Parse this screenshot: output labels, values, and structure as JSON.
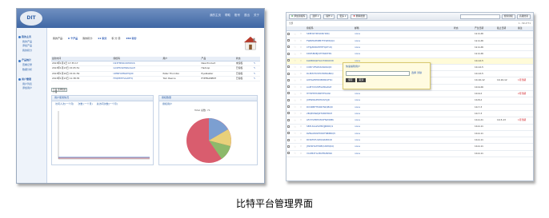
{
  "caption": "比特平台管理界面",
  "left": {
    "logo": "DIT",
    "top_links": [
      "我的主页",
      "帮助",
      "账号",
      "退出",
      "关于"
    ],
    "sidebar": [
      {
        "head": "我的主页",
        "items": [
          "我的产品",
          "添加产品",
          "我的积分"
        ]
      },
      {
        "head": "产品统计",
        "items": [
          "查看记录",
          "数据分析"
        ]
      },
      {
        "head": "用户管理",
        "items": [
          "用户列表",
          "添加用户"
        ]
      }
    ],
    "stats": {
      "label1": "我的产品:",
      "value1": "6 个产品",
      "label2": "我的积分:",
      "value2": "11 积分",
      "label3": "积 分 值:",
      "value3": "150 积分"
    },
    "table": {
      "headers": [
        "最新时间",
        "授权码",
        "用户",
        "产品",
        "状态",
        ""
      ],
      "rows": [
        [
          "2013年1月1日 17:35:17",
          "D23FMWKXDHWC6",
          "",
          "New Product",
          "未授权",
          "✎"
        ],
        [
          "2013年1月13日 15:05:51",
          "GCRFKSRHRAQGAH",
          "",
          "Hadoop",
          "已授权",
          "✎"
        ],
        [
          "2013年1月10日 15:01:59",
          "UMNTCMMAH5J9X",
          "Peter Thornton",
          "Eyeblaster",
          "已授权",
          "✎"
        ],
        [
          "2013年1月13日 11:38:35",
          "FPQE8THVGXEFQ",
          "Tom Pearce",
          "EYEFRAMENT",
          "已授权",
          "✎"
        ]
      ]
    },
    "product_select": "产品 选择您的产品",
    "panel1": {
      "title": "用户使用情况",
      "legend": [
        "访问人次(一个月)",
        "次数 (一个月)",
        "总访问次数(一个月)"
      ]
    },
    "panel2": {
      "title": "授权数量",
      "legend": [
        "授权用户"
      ],
      "pie_label": "Total 总数: 71"
    }
  },
  "right": {
    "toolbar": {
      "add": "添加授权码",
      "select": "选择",
      "ops": "操作",
      "more": "更多",
      "delete": "删除批量",
      "search_btn": "搜索授权",
      "advanced": "高级搜索"
    },
    "pager": {
      "left": "全部",
      "right": "1 - 50 of 71"
    },
    "headers": [
      "",
      "",
      "",
      "授权码",
      "邮箱",
      "状态",
      "产生日期",
      "截止日期",
      "备注"
    ],
    "rows": [
      [
        "SRM3Z7ZKSKNYKRQ",
        "none",
        "12-4-26",
        "",
        ""
      ],
      [
        "FWREDZMPB7FXWMQQ4",
        "none",
        "12-4-26",
        "",
        ""
      ],
      [
        "CTSJZDRKHEHFQZ7UQ",
        "none",
        "12-4-26",
        "",
        ""
      ],
      [
        "KDR5BDEJCPT6WKTRS",
        "none",
        "12-4-26",
        "",
        ""
      ],
      [
        "KLWB0QWYACYDRDAYW",
        "none",
        "10-12-5",
        "",
        ""
      ],
      [
        "CUB7UFSRSSDWAKQD",
        "none",
        "10-12-5",
        "",
        ""
      ],
      [
        "DLEMVHVKTCHRMGBKQ",
        "none",
        "10-12-5",
        "",
        ""
      ],
      [
        "LNHGZBHD9EZRR4FSC",
        "none",
        "10-10-12",
        "10-10-12",
        "1月到期"
      ],
      [
        "LGEHYXUMFGMRLZGE",
        "none",
        "10-9-26",
        "",
        ""
      ],
      [
        "HTHPTPHXBPHT5GWI",
        "none",
        "10-9-2",
        "",
        "2月到期"
      ],
      [
        "JUPWNGPWHK9VQJD",
        "none",
        "10-8-2",
        "",
        ""
      ],
      [
        "DUSBBTTMXRHWQBQD",
        "none",
        "10-7-3",
        "",
        ""
      ],
      [
        "2BQEDNWJZTKBKTRKH",
        "none",
        "10-7-3",
        "",
        ""
      ],
      [
        "LEOYSHBHUMXFNWRMK",
        "none",
        "10-4-21",
        "10-5-13",
        "1月到期"
      ],
      [
        "SEZUGGZGHBVJJRRRQ1",
        "none",
        "10-4-11",
        "",
        ""
      ],
      [
        "RZNAKEAPHWDFNBMRQ5",
        "none",
        "10-4-11",
        "",
        ""
      ],
      [
        "RCSMSTU4ZQGRZNQD",
        "none",
        "10-4-11",
        "",
        ""
      ],
      [
        "JHWKHGTHNEQUNHQKQ",
        "none",
        "10-4-11",
        "",
        ""
      ],
      [
        "VCZMXTGXBUFRZNW6",
        "none",
        "10-4-11",
        "",
        ""
      ]
    ],
    "dialog": {
      "title": "快速编辑用户",
      "ok": "保存",
      "cancel": "取消",
      "links": "选择 清除"
    }
  }
}
